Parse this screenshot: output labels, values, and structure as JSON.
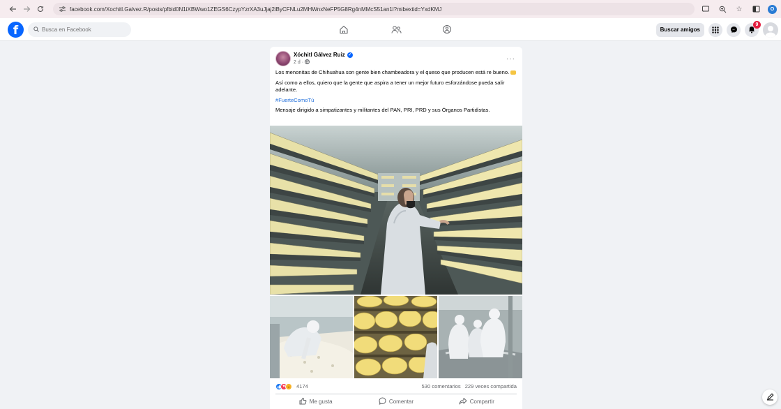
{
  "browser": {
    "url": "facebook.com/Xochitl.Galvez.R/posts/pfbid0N1iXBWwo1ZEGS6CzypYzrXA3uJjaj2iByCFNLu2MHWnxNeFP5G8Rg4nMMcS51an1l?mibextid=YxdKMJ",
    "profile_initial": "O",
    "icons": [
      "back-icon",
      "forward-icon",
      "reload-icon",
      "site-info-icon",
      "cast-icon",
      "zoom-icon",
      "bookmark-star-icon",
      "sidebar-icon",
      "profile-icon"
    ]
  },
  "header": {
    "search_placeholder": "Busca en Facebook",
    "find_friends_label": "Buscar amigos",
    "notification_count": "9",
    "nav_icons": [
      "home-icon",
      "friends-icon",
      "groups-icon"
    ]
  },
  "post": {
    "author": "Xóchitl Gálvez Ruiz",
    "time": "2 d",
    "paragraphs": [
      "Los menonitas de Chihuahua son gente bien chambeadora y el queso que producen está re bueno.",
      "Así como a ellos, quiero que la gente que aspira a tener un mejor futuro esforzándose pueda salir adelante."
    ],
    "hashtag": "#FuerteComoTú",
    "disclaimer": "Mensaje dirigido a simpatizantes y militantes del PAN, PRI, PRD y sus Órganos Partidistas.",
    "reaction_count": "4174",
    "comments": "530 comentarios",
    "shares": "229 veces compartida",
    "actions": {
      "like": "Me gusta",
      "comment": "Comentar",
      "share": "Compartir"
    }
  },
  "colors": {
    "facebook_blue": "#0866ff",
    "notification_red": "#e41e3f",
    "hashtag": "#216fdb",
    "page_bg": "#f0f2f5"
  }
}
